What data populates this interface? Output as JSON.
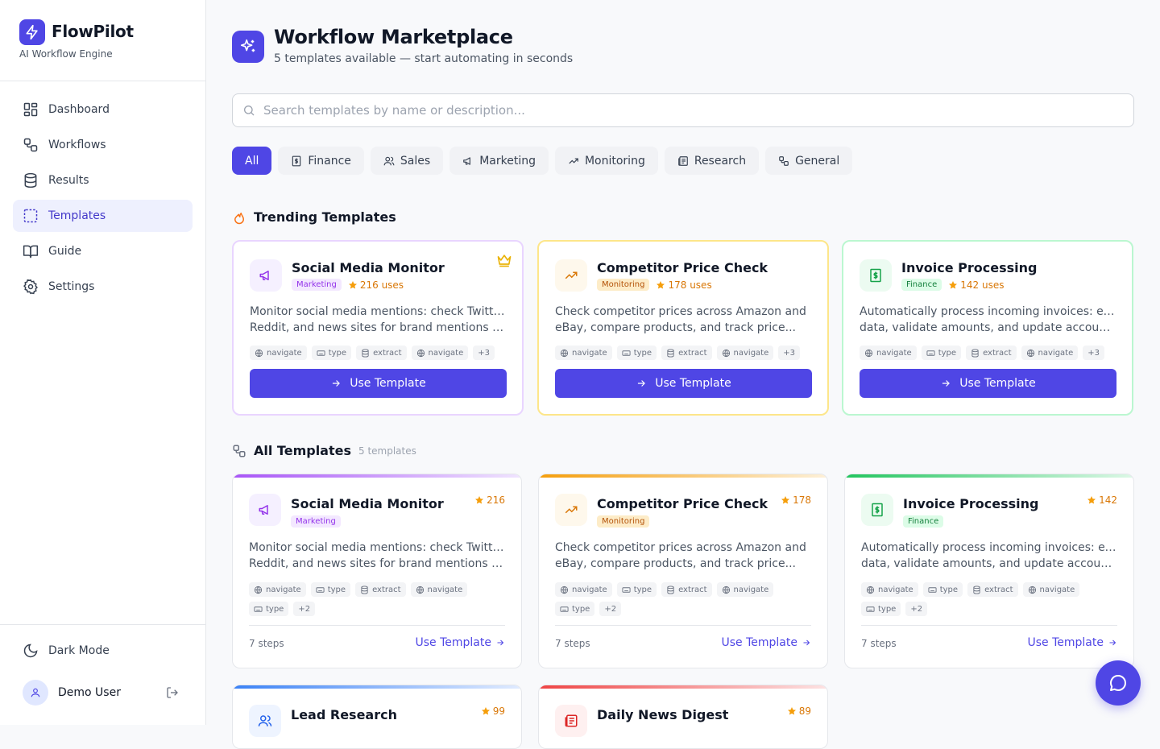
{
  "brand": {
    "name": "FlowPilot",
    "subtitle": "AI Workflow Engine"
  },
  "nav": [
    {
      "label": "Dashboard",
      "icon": "dashboard-icon",
      "active": false
    },
    {
      "label": "Workflows",
      "icon": "workflow-icon",
      "active": false
    },
    {
      "label": "Results",
      "icon": "database-icon",
      "active": false
    },
    {
      "label": "Templates",
      "icon": "templates-icon",
      "active": true
    },
    {
      "label": "Guide",
      "icon": "book-icon",
      "active": false
    },
    {
      "label": "Settings",
      "icon": "gear-icon",
      "active": false
    }
  ],
  "sidebar_footer": {
    "dark_mode_label": "Dark Mode",
    "user_name": "Demo User"
  },
  "header": {
    "title": "Workflow Marketplace",
    "subtitle": "5 templates available — start automating in seconds"
  },
  "search": {
    "placeholder": "Search templates by name or description..."
  },
  "filters": [
    {
      "label": "All",
      "active": true
    },
    {
      "label": "Finance",
      "icon": "receipt-icon"
    },
    {
      "label": "Sales",
      "icon": "users-icon"
    },
    {
      "label": "Marketing",
      "icon": "megaphone-icon"
    },
    {
      "label": "Monitoring",
      "icon": "trending-up-icon"
    },
    {
      "label": "Research",
      "icon": "newspaper-icon"
    },
    {
      "label": "General",
      "icon": "workflow-icon"
    }
  ],
  "trending": {
    "title": "Trending Templates",
    "cards": [
      {
        "title": "Social Media Monitor",
        "category": "Marketing",
        "uses": "216 uses",
        "desc1": "Monitor social media mentions: check Twitter,",
        "desc2": "Reddit, and news sites for brand mentions and...",
        "tags": [
          "navigate",
          "type",
          "extract",
          "navigate"
        ],
        "more": "+3",
        "button": "Use Template",
        "color": "#9333ea"
      },
      {
        "title": "Competitor Price Check",
        "category": "Monitoring",
        "uses": "178 uses",
        "desc1": "Check competitor prices across Amazon and",
        "desc2": "eBay, compare products, and track price...",
        "tags": [
          "navigate",
          "type",
          "extract",
          "navigate"
        ],
        "more": "+3",
        "button": "Use Template",
        "color": "#d97706"
      },
      {
        "title": "Invoice Processing",
        "category": "Finance",
        "uses": "142 uses",
        "desc1": "Automatically process incoming invoices: extract",
        "desc2": "data, validate amounts, and update accountin...",
        "tags": [
          "navigate",
          "type",
          "extract",
          "navigate"
        ],
        "more": "+3",
        "button": "Use Template",
        "color": "#16a34a"
      }
    ]
  },
  "all": {
    "title": "All Templates",
    "count": "5 templates",
    "cards": [
      {
        "title": "Social Media Monitor",
        "category": "Marketing",
        "stars": "216",
        "desc1": "Monitor social media mentions: check Twitter,",
        "desc2": "Reddit, and news sites for brand mentions and...",
        "tags": [
          "navigate",
          "type",
          "extract",
          "navigate",
          "type"
        ],
        "more": "+2",
        "steps": "7 steps",
        "link": "Use Template"
      },
      {
        "title": "Competitor Price Check",
        "category": "Monitoring",
        "stars": "178",
        "desc1": "Check competitor prices across Amazon and",
        "desc2": "eBay, compare products, and track price...",
        "tags": [
          "navigate",
          "type",
          "extract",
          "navigate",
          "type"
        ],
        "more": "+2",
        "steps": "7 steps",
        "link": "Use Template"
      },
      {
        "title": "Invoice Processing",
        "category": "Finance",
        "stars": "142",
        "desc1": "Automatically process incoming invoices: extract",
        "desc2": "data, validate amounts, and update accountin...",
        "tags": [
          "navigate",
          "type",
          "extract",
          "navigate",
          "type"
        ],
        "more": "+2",
        "steps": "7 steps",
        "link": "Use Template"
      },
      {
        "title": "Lead Research",
        "stars": "99"
      },
      {
        "title": "Daily News Digest",
        "stars": "89"
      }
    ]
  },
  "colors": {
    "accent": "#4f46e5",
    "marketing": "#9333ea",
    "monitoring": "#d97706",
    "finance": "#16a34a",
    "sales": "#2563eb",
    "research": "#dc2626",
    "star": "#f59e0b"
  }
}
